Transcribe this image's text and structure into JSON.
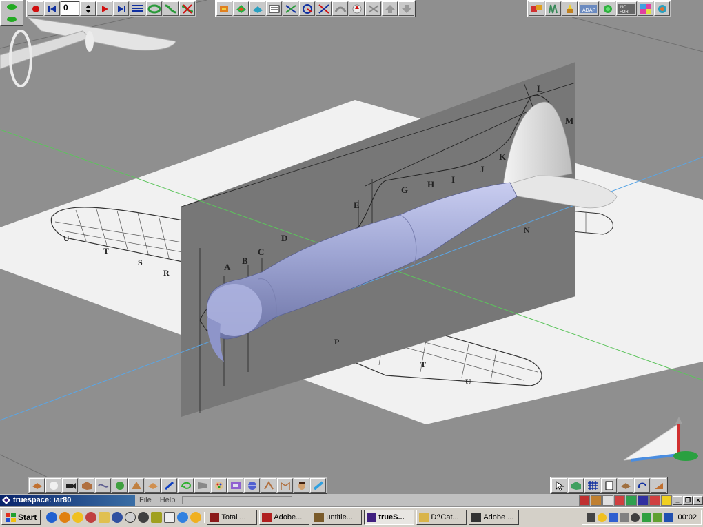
{
  "window": {
    "title": "truespace: iar80"
  },
  "menu": [
    {
      "label": "File"
    },
    {
      "label": "Help"
    }
  ],
  "animation": {
    "frame": "0"
  },
  "blueprint": {
    "side_letters": [
      "A",
      "B",
      "C",
      "D",
      "E",
      "G",
      "H",
      "I",
      "J",
      "K",
      "L",
      "M"
    ],
    "wing_letters": [
      "U",
      "T",
      "S",
      "R",
      "P",
      "N",
      "L",
      "M"
    ]
  },
  "taskbar": {
    "start_label": "Start",
    "tasks": [
      {
        "label": "Total ...",
        "active": false,
        "color": "#8b1a1a"
      },
      {
        "label": "Adobe...",
        "active": false,
        "color": "#b02020"
      },
      {
        "label": "untitle...",
        "active": false,
        "color": "#7a5b2a"
      },
      {
        "label": "trueS...",
        "active": true,
        "color": "#402080"
      },
      {
        "label": "D:\\Cat...",
        "active": false,
        "color": "#d9b44a"
      },
      {
        "label": "Adobe ...",
        "active": false,
        "color": "#333333"
      }
    ],
    "clock": "00:02"
  },
  "colors": {
    "fuselage": "#9fa6d4",
    "paper": "#f1f1f1",
    "wall": "#777777",
    "accent_titlebar": "#0a246a"
  },
  "icons": {
    "top_left_toolbar": [
      "record-icon",
      "rewind-icon",
      "frame-stepper-icon",
      "play-icon",
      "end-icon",
      "timeline-icon",
      "spline-icon",
      "path-icon",
      "delete-path-icon"
    ],
    "top_mid_toolbar": [
      "object-navigate-icon",
      "eye-move-icon",
      "material-icon",
      "paint-icon",
      "text-icon",
      "move-icon",
      "rotate-icon",
      "scale-icon",
      "deform-icon",
      "axis-icon",
      "reset-icon",
      "up-icon",
      "down-icon"
    ],
    "top_right_toolbar": [
      "materials-library-icon",
      "render-icon",
      "light-icon",
      "scene-icon",
      "globe-icon",
      "no-fog-icon",
      "palette-icon",
      "help-icon"
    ],
    "bottom_left_toolbar": [
      "plane-primitive-icon",
      "sphere-primitive-icon",
      "camera-icon",
      "cube-primitive-icon",
      "lathe-icon",
      "sweep-icon",
      "cone-icon",
      "tile-icon",
      "paint-brush-icon",
      "lasso-icon",
      "flag-icon",
      "color-palette-icon",
      "texture-icon",
      "wireframe-icon",
      "bone-icon",
      "figure-icon",
      "face-icon",
      "tape-icon"
    ],
    "bottom_right_toolbar": [
      "pointer-icon",
      "object-icon",
      "grid-icon",
      "file-icon",
      "hierarchy-icon",
      "undo-icon",
      "redo-icon"
    ]
  }
}
